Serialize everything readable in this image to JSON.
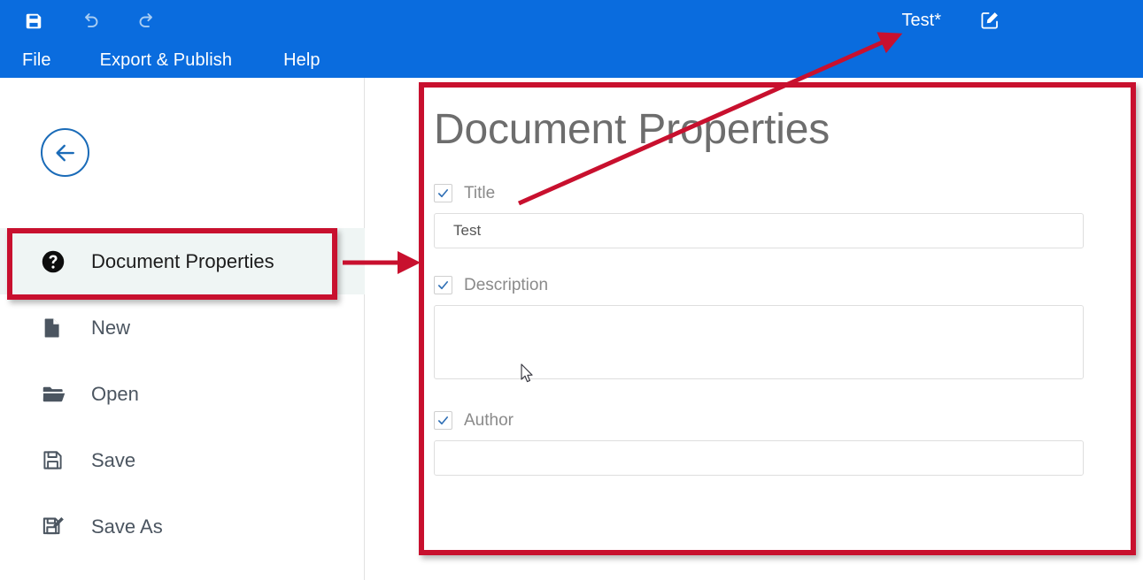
{
  "app": {
    "header_bg": "#0a6cde",
    "accent_red": "#c8102e"
  },
  "toolbar": {
    "buttons": [
      {
        "name": "save-icon",
        "label": "Save"
      },
      {
        "name": "undo-icon",
        "label": "Undo"
      },
      {
        "name": "redo-icon",
        "label": "Redo"
      }
    ]
  },
  "menubar": {
    "items": [
      {
        "label": "File"
      },
      {
        "label": "Export & Publish"
      },
      {
        "label": "Help"
      }
    ]
  },
  "document": {
    "title": "Test*",
    "edit_icon": "edit-pencil-square-icon"
  },
  "sidebar": {
    "back_button": "back-arrow-icon",
    "items": [
      {
        "label": "Document Properties",
        "icon": "question-mark-circle-icon",
        "selected": true
      },
      {
        "label": "New",
        "icon": "file-icon",
        "selected": false
      },
      {
        "label": "Open",
        "icon": "folder-open-icon",
        "selected": false
      },
      {
        "label": "Save",
        "icon": "floppy-disk-icon",
        "selected": false
      },
      {
        "label": "Save As",
        "icon": "floppy-disk-pencil-icon",
        "selected": false
      }
    ]
  },
  "panel": {
    "heading": "Document Properties",
    "fields": [
      {
        "label": "Title",
        "checked": true,
        "type": "input",
        "value": "Test",
        "placeholder": ""
      },
      {
        "label": "Description",
        "checked": true,
        "type": "textarea",
        "value": "",
        "placeholder": ""
      },
      {
        "label": "Author",
        "checked": true,
        "type": "input",
        "value": "",
        "placeholder": ""
      }
    ]
  },
  "annotations": {
    "highlight_sidebar_item": "Document Properties",
    "highlight_panel": "Document Properties",
    "arrow_to_panel": "sidebar-item-to-panel",
    "arrow_to_title": "title-field-to-document-title"
  }
}
